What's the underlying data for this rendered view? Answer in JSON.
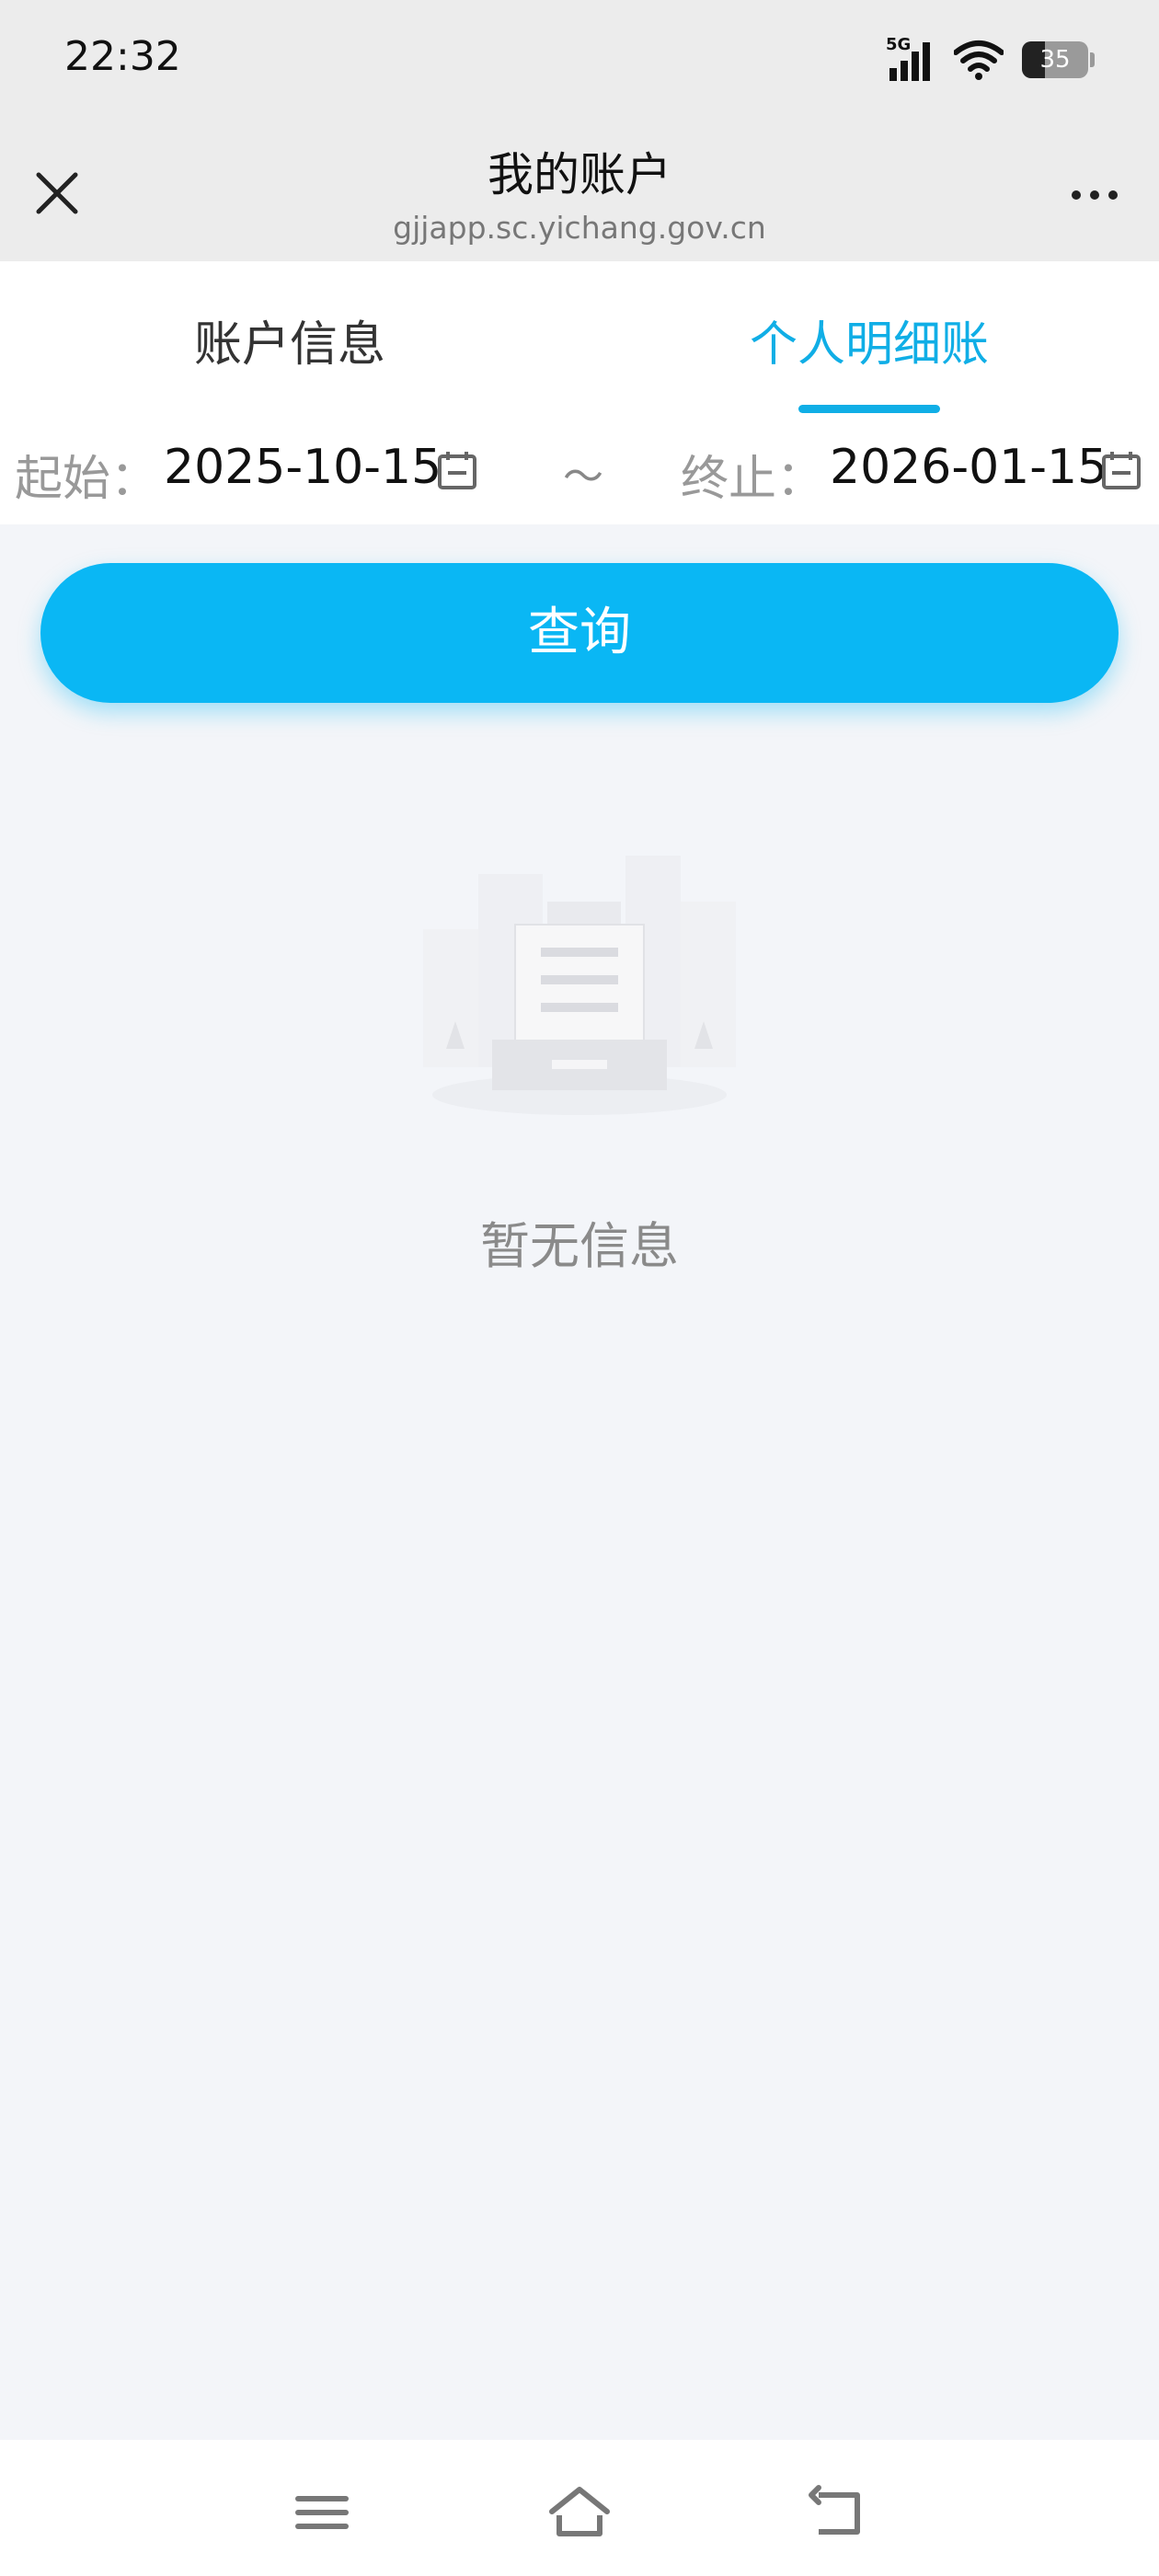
{
  "status_bar": {
    "time": "22:32",
    "network": "5G",
    "battery_level": 35,
    "battery_label": "35",
    "icons": [
      "signal-icon",
      "wifi-icon",
      "battery-icon"
    ]
  },
  "header": {
    "title": "我的账户",
    "url": "gjjapp.sc.yichang.gov.cn",
    "close_icon": "close-icon",
    "more_icon": "more-icon"
  },
  "tabs": [
    {
      "label": "账户信息",
      "active": false
    },
    {
      "label": "个人明细账",
      "active": true
    }
  ],
  "date_range": {
    "start_label": "起始：",
    "start_value": "2025-10-15",
    "separator": "～",
    "end_label": "终止：",
    "end_value": "2026-01-15",
    "icon": "calendar-icon"
  },
  "query_button": {
    "label": "查询"
  },
  "empty_state": {
    "message": "暂无信息",
    "icon": "empty-document-icon"
  },
  "nav_bar": {
    "icons": [
      "menu-icon",
      "home-icon",
      "back-icon"
    ]
  },
  "colors": {
    "accent": "#10aee6",
    "button": "#0ab7f4",
    "background": "#f3f5f9"
  }
}
